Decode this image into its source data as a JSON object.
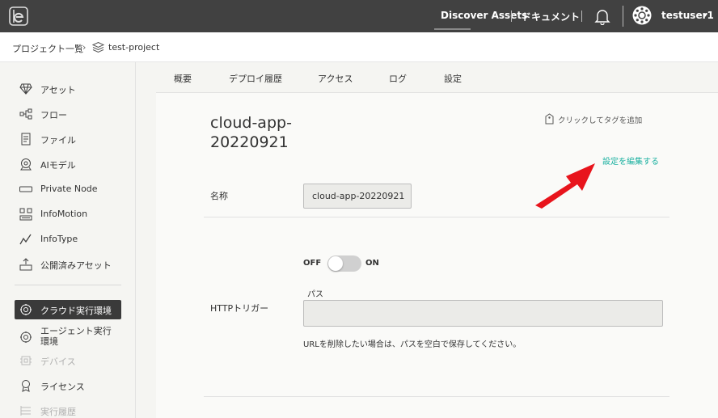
{
  "topbar": {
    "discover_assets": "Discover Assets",
    "documents": "ドキュメント",
    "username": "testuser1"
  },
  "breadcrumb": {
    "projects": "プロジェクト一覧",
    "separator": "›",
    "current": "test-project"
  },
  "sidebar": {
    "items": [
      {
        "label": "アセット",
        "icon": "diamond-icon"
      },
      {
        "label": "フロー",
        "icon": "flow-icon"
      },
      {
        "label": "ファイル",
        "icon": "file-icon"
      },
      {
        "label": "AIモデル",
        "icon": "ai-model-icon"
      },
      {
        "label": "Private Node",
        "icon": "node-icon"
      },
      {
        "label": "InfoMotion",
        "icon": "infomotion-icon"
      },
      {
        "label": "InfoType",
        "icon": "infotype-icon"
      },
      {
        "label": "公開済みアセット",
        "icon": "published-icon"
      },
      {
        "label": "クラウド実行環境",
        "icon": "cloud-runtime-icon",
        "active": true
      },
      {
        "label": "エージェント実行環境",
        "icon": "agent-icon"
      },
      {
        "label": "デバイス",
        "icon": "device-icon",
        "disabled": true
      },
      {
        "label": "ライセンス",
        "icon": "license-icon"
      },
      {
        "label": "実行履歴",
        "icon": "history-icon",
        "disabled": true
      }
    ]
  },
  "tabs": [
    {
      "label": "概要"
    },
    {
      "label": "デプロイ履歴"
    },
    {
      "label": "アクセス"
    },
    {
      "label": "ログ"
    },
    {
      "label": "設定",
      "active": true
    }
  ],
  "main": {
    "title_line1": "cloud-app-",
    "title_line2": "20220921",
    "add_tag": "クリックしてタグを追加",
    "edit_settings": "設定を編集する",
    "name_label": "名称",
    "name_value": "cloud-app-20220921",
    "http_trigger_label": "HTTPトリガー",
    "toggle_off": "OFF",
    "toggle_on": "ON",
    "toggle_state": "off",
    "path_label": "パス",
    "path_value": "",
    "help_text": "URLを削除したい場合は、パスを空白で保存してください。"
  },
  "colors": {
    "topbar": "#414141",
    "accent_link": "#1ab0a0",
    "arrow": "#e8141c",
    "active_sidebar": "#3a3a3a"
  }
}
